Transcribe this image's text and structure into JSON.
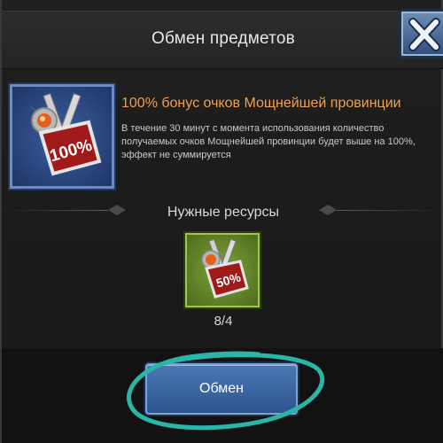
{
  "dialog": {
    "title": "Обмен предметов"
  },
  "item": {
    "title": "100% бонус очков Мощнейшей провинции",
    "description": "В течение 30 минут с момента использования количество получаемых очков Мощнейшей провинции будет выше на 100%, эффект не суммируется",
    "badge_text": "100%",
    "icon": "crossed-swords-medal-icon"
  },
  "resources": {
    "heading": "Нужные ресурсы",
    "item": {
      "badge_text": "50%",
      "icon": "crossed-swords-medal-icon",
      "count": "8/4"
    }
  },
  "actions": {
    "exchange_label": "Обмен"
  },
  "colors": {
    "title_orange": "#f0a24d",
    "button_blue": "#3b67a3",
    "item_frame_blue": "#6d8cc4",
    "resource_frame_green": "#9fc84b",
    "marker_teal": "#2bb5a7"
  }
}
